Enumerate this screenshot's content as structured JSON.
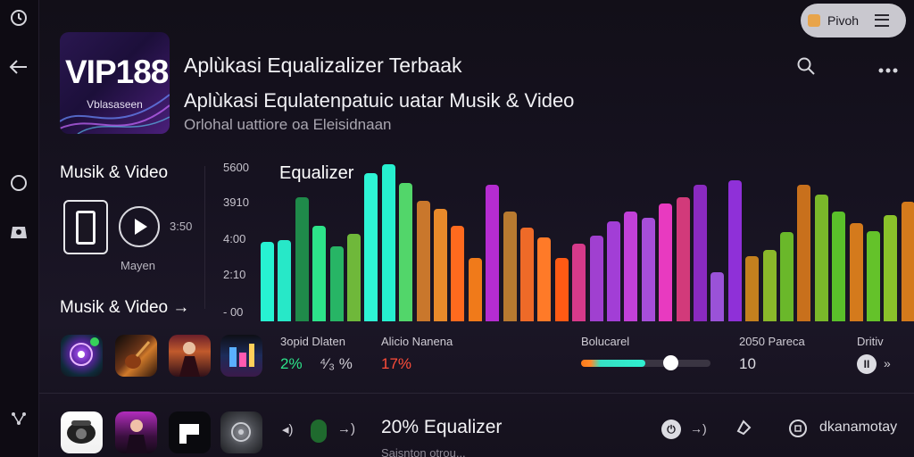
{
  "header": {
    "pill_label": "Pivoh"
  },
  "app": {
    "icon_brand": "VIP188",
    "icon_sub": "Vblasaseen",
    "title": "Aplùkasi Equalizalizer Terbaak",
    "subtitle": "Aplùkasi Equlatenpatuic uatar Musik & Video",
    "developer": "Orlohal uattiore oa Eleisidnaan"
  },
  "left_panel": {
    "section1_title": "Musik & Video",
    "play_time": "3:50",
    "caption": "Mayen",
    "section2_title": "Musik & Video →"
  },
  "equalizer": {
    "label": "Equalizer",
    "y_ticks": [
      "5600",
      "3910",
      "4:00",
      "2:10",
      "- 00"
    ],
    "bands": [
      {
        "value": 0.5,
        "color": "#27f2d2"
      },
      {
        "value": 0.51,
        "color": "#27e8c8"
      },
      {
        "value": 0.78,
        "color": "#1f8a4a"
      },
      {
        "value": 0.6,
        "color": "#2de38a"
      },
      {
        "value": 0.47,
        "color": "#27b565"
      },
      {
        "value": 0.55,
        "color": "#6fb83a"
      },
      {
        "value": 0.93,
        "color": "#2ef5d5"
      },
      {
        "value": 0.99,
        "color": "#26f0cf"
      },
      {
        "value": 0.87,
        "color": "#52d66a"
      },
      {
        "value": 0.76,
        "color": "#c9772c"
      },
      {
        "value": 0.71,
        "color": "#e88a2a"
      },
      {
        "value": 0.6,
        "color": "#ff6a1e"
      },
      {
        "value": 0.4,
        "color": "#f07a1a"
      },
      {
        "value": 0.86,
        "color": "#b52cd1"
      },
      {
        "value": 0.69,
        "color": "#b87a30"
      },
      {
        "value": 0.59,
        "color": "#ee6a28"
      },
      {
        "value": 0.53,
        "color": "#ff7a28"
      },
      {
        "value": 0.4,
        "color": "#ff5a14"
      },
      {
        "value": 0.49,
        "color": "#d63a8a"
      },
      {
        "value": 0.54,
        "color": "#a040d0"
      },
      {
        "value": 0.63,
        "color": "#a23ed6"
      },
      {
        "value": 0.69,
        "color": "#c240d8"
      },
      {
        "value": 0.65,
        "color": "#a64ed9"
      },
      {
        "value": 0.74,
        "color": "#e83ac0"
      },
      {
        "value": 0.78,
        "color": "#d23a7a"
      },
      {
        "value": 0.86,
        "color": "#8a2ac0"
      },
      {
        "value": 0.31,
        "color": "#9a52d8"
      },
      {
        "value": 0.89,
        "color": "#8f30d8"
      },
      {
        "value": 0.41,
        "color": "#c4801e"
      },
      {
        "value": 0.45,
        "color": "#8ab82a"
      },
      {
        "value": 0.56,
        "color": "#6ab82a"
      },
      {
        "value": 0.86,
        "color": "#c8701c"
      },
      {
        "value": 0.8,
        "color": "#7ab82a"
      },
      {
        "value": 0.69,
        "color": "#5ac02a"
      },
      {
        "value": 0.62,
        "color": "#d47a1c"
      },
      {
        "value": 0.57,
        "color": "#64c22a"
      },
      {
        "value": 0.67,
        "color": "#8ac22a"
      },
      {
        "value": 0.75,
        "color": "#d47a1c"
      },
      {
        "value": 0.86,
        "color": "#e08a1c"
      }
    ]
  },
  "stats": {
    "col1_label": "3opid Dlaten",
    "col1_val_a": "2%",
    "col1_val_b": "⁴⁄₃ %",
    "col2_label": "Alicio Nanena",
    "col2_val": "17%",
    "col3_label": "Bolucarel",
    "slider_value": 0.69,
    "col4_label": "2050 Pareca",
    "col4_val": "10",
    "col5_label": "Dritiv"
  },
  "bottom": {
    "eq_text": "20% Equalizer",
    "trailing": "dkanamotay",
    "partial_line": "Saisnton otrou..."
  },
  "colors": {
    "cyan": "#27f2d2",
    "green": "#2de38a",
    "red": "#ff4d3a",
    "accent": "#a040d0"
  }
}
